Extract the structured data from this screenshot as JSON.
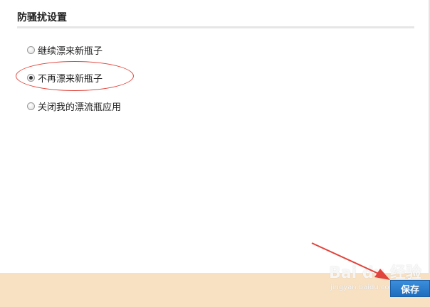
{
  "settings": {
    "section_title": "防骚扰设置",
    "options": [
      {
        "label": "继续漂来新瓶子",
        "checked": false
      },
      {
        "label": "不再漂来新瓶子",
        "checked": true
      },
      {
        "label": "关闭我的漂流瓶应用",
        "checked": false
      }
    ]
  },
  "footer": {
    "save_label": "保存"
  },
  "watermark": {
    "logo": "Bai du 经验",
    "url": "jingyan.baidu.com"
  },
  "colors": {
    "annotation": "#e0443c",
    "footer_bg": "#f8e1c2",
    "button": "#1f6dbe"
  }
}
